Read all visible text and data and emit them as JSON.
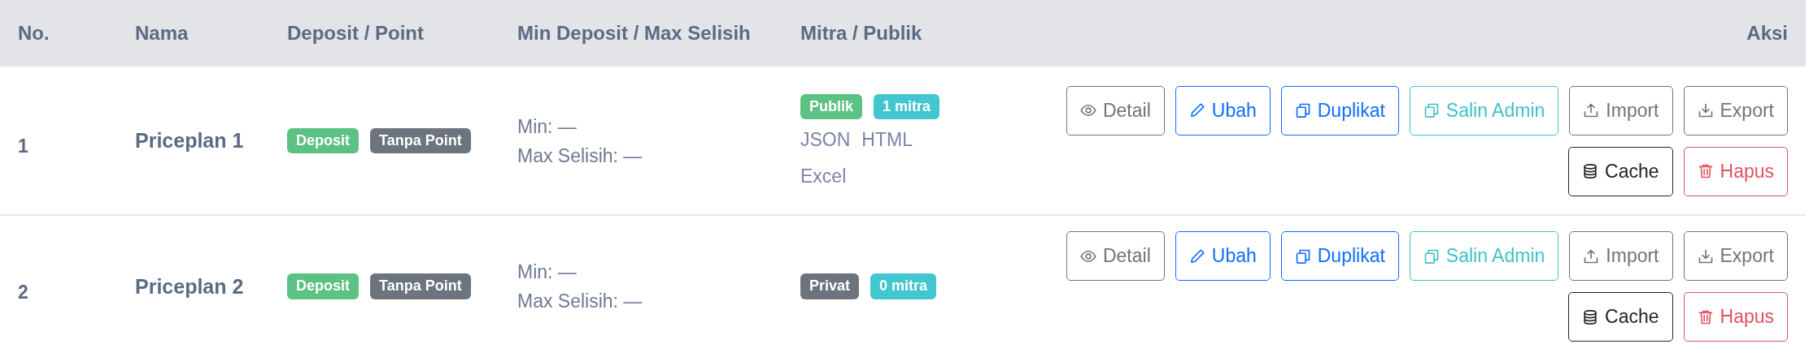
{
  "table": {
    "columns": [
      "No.",
      "Nama",
      "Deposit / Point",
      "Min Deposit / Max Selisih",
      "Mitra / Publik",
      "Aksi"
    ],
    "rows": [
      {
        "no": "1",
        "name": "Priceplan 1",
        "deposit_badges": [
          {
            "label": "Deposit",
            "kind": "success"
          },
          {
            "label": "Tanpa Point",
            "kind": "secondary"
          }
        ],
        "min": "Min: —",
        "max": "Max Selisih: —",
        "mitra_badges": [
          {
            "label": "Publik",
            "kind": "success"
          },
          {
            "label": "1 mitra",
            "kind": "info"
          }
        ],
        "links": [
          "JSON",
          "HTML",
          "Excel"
        ],
        "actions": [
          {
            "label": "Detail",
            "kind": "secondary"
          },
          {
            "label": "Ubah",
            "kind": "primary"
          },
          {
            "label": "Duplikat",
            "kind": "primary"
          },
          {
            "label": "Salin Admin",
            "kind": "info"
          },
          {
            "label": "Import",
            "kind": "secondary"
          },
          {
            "label": "Export",
            "kind": "secondary"
          },
          {
            "label": "Cache",
            "kind": "dark"
          },
          {
            "label": "Hapus",
            "kind": "danger"
          }
        ]
      },
      {
        "no": "2",
        "name": "Priceplan 2",
        "deposit_badges": [
          {
            "label": "Deposit",
            "kind": "success"
          },
          {
            "label": "Tanpa Point",
            "kind": "secondary"
          }
        ],
        "min": "Min: —",
        "max": "Max Selisih: —",
        "mitra_badges": [
          {
            "label": "Privat",
            "kind": "secondary"
          },
          {
            "label": "0 mitra",
            "kind": "info"
          }
        ],
        "actions": [
          {
            "label": "Detail",
            "kind": "secondary"
          },
          {
            "label": "Ubah",
            "kind": "primary"
          },
          {
            "label": "Duplikat",
            "kind": "primary"
          },
          {
            "label": "Salin Admin",
            "kind": "info"
          },
          {
            "label": "Import",
            "kind": "secondary"
          },
          {
            "label": "Export",
            "kind": "secondary"
          },
          {
            "label": "Cache",
            "kind": "dark"
          },
          {
            "label": "Hapus",
            "kind": "danger"
          }
        ]
      }
    ]
  }
}
